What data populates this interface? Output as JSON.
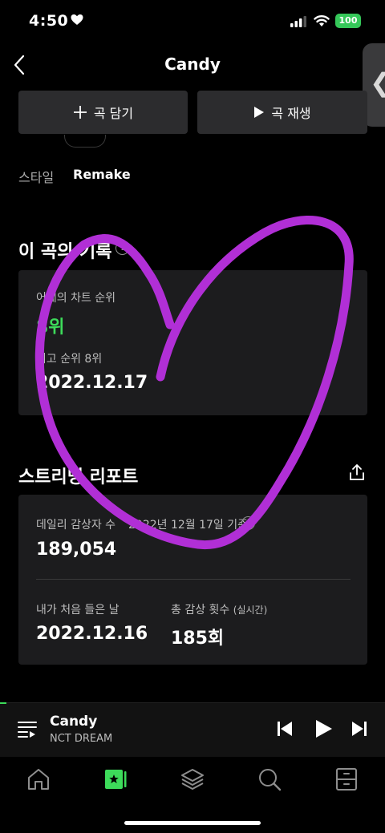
{
  "status": {
    "time": "4:50",
    "battery": "100"
  },
  "header": {
    "title": "Candy"
  },
  "actions": {
    "add_label": "곡 담기",
    "play_label": "곡 재생"
  },
  "style_row": {
    "label": "스타일",
    "value": "Remake"
  },
  "record": {
    "title": "이 곡의 기록",
    "yesterday_label": "어제의 차트 순위",
    "yesterday_value": "8위",
    "best_label": "최고 순위 8위",
    "best_date": "2022.12.17"
  },
  "report": {
    "title": "스트리밍 리포트",
    "daily_label": "데일리 감상자 수",
    "daily_basis": "2022년 12월 17일 기준",
    "daily_value": "189,054",
    "first_listen_label": "내가 처음 들은 날",
    "first_listen_value": "2022.12.16",
    "total_label": "총 감상 횟수",
    "total_note": "(실시간)",
    "total_value": "185회"
  },
  "player": {
    "song": "Candy",
    "artist": "NCT DREAM"
  },
  "tabs": [
    "home-icon",
    "library-icon",
    "layers-icon",
    "search-icon",
    "storage-icon"
  ],
  "colors": {
    "accent_green": "#3ddb5a",
    "annotation_purple": "#b12fd6",
    "card_bg": "#1c1c1e"
  }
}
